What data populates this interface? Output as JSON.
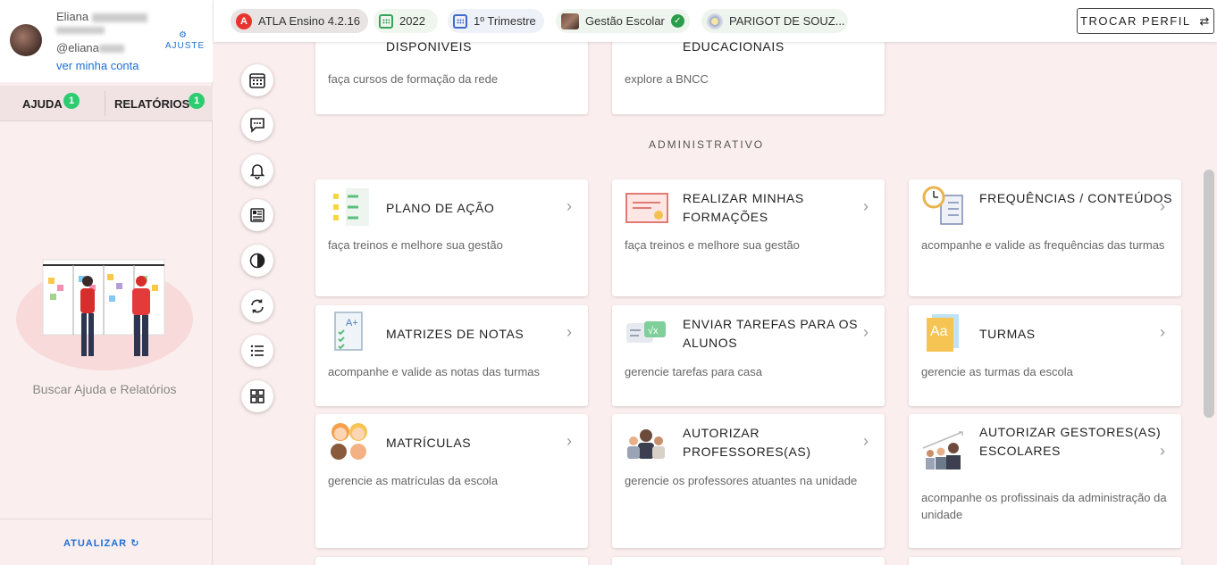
{
  "user": {
    "first_name": "Eliana",
    "handle": "@eliana",
    "view_account": "ver minha conta",
    "adjust_label": "AJUSTE"
  },
  "help_tabs": [
    {
      "label": "AJUDA",
      "badge": "1"
    },
    {
      "label": "RELATÓRIOS",
      "badge": "1"
    }
  ],
  "help_caption": "Buscar Ajuda e Relatórios",
  "refresh_label": "ATUALIZAR",
  "topbar": {
    "chips": [
      {
        "label": "ATLA Ensino 4.2.16",
        "icon": "atla-logo-icon"
      },
      {
        "label": "2022",
        "icon": "calendar-icon"
      },
      {
        "label": "1º Trimestre",
        "icon": "calendar-icon"
      },
      {
        "label": "Gestão Escolar",
        "icon": "profile-photo-icon"
      },
      {
        "label": "PARIGOT DE SOUZ...",
        "icon": "school-seal-icon"
      }
    ],
    "switch_profile": "TROCAR PERFIL"
  },
  "section_label": "ADMINISTRATIVO",
  "cards_top": [
    {
      "title": "DISPONÍVEIS",
      "desc": "faça cursos de formação da rede"
    },
    {
      "title": "EDUCACIONAIS",
      "desc": "explore a BNCC"
    }
  ],
  "cards": [
    {
      "title": "PLANO DE AÇÃO",
      "desc": "faça treinos e melhore sua gestão"
    },
    {
      "title": "REALIZAR MINHAS FORMAÇÕES",
      "desc": "faça treinos e melhore sua gestão"
    },
    {
      "title": "FREQUÊNCIAS / CONTEÚDOS",
      "desc": "acompanhe e valide as frequências das turmas"
    },
    {
      "title": "MATRIZES DE NOTAS",
      "desc": "acompanhe e valide as notas das turmas"
    },
    {
      "title": "ENVIAR TAREFAS PARA OS ALUNOS",
      "desc": "gerencie tarefas para casa"
    },
    {
      "title": "TURMAS",
      "desc": "gerencie as turmas da escola"
    },
    {
      "title": "MATRÍCULAS",
      "desc": "gerencie as matrículas da escola"
    },
    {
      "title": "AUTORIZAR PROFESSORES(AS)",
      "desc": "gerencie os professores atuantes na unidade"
    },
    {
      "title": "AUTORIZAR GESTORES(AS) ESCOLARES",
      "desc": "acompanhe os profissinais da administração da unidade"
    }
  ],
  "colors": {
    "accent": "#1d6fd6",
    "highlight": "#e3161b",
    "badge": "#2ecc71"
  }
}
